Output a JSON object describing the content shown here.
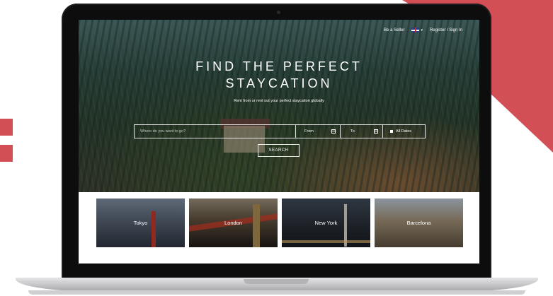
{
  "nav": {
    "be_seller": "Be a Seller",
    "register": "Register / Sign In",
    "language_icon": "uk-flag-icon"
  },
  "hero": {
    "headline_line1": "FIND THE PERFECT",
    "headline_line2": "STAYCATION",
    "tagline": "Rent from or rent out your perfect staycation globally"
  },
  "search": {
    "where_placeholder": "Where do you want to go?",
    "from_label": "From",
    "to_label": "To",
    "all_dates_label": "All Dates",
    "button_label": "SEARCH"
  },
  "cities": [
    {
      "name": "Tokyo"
    },
    {
      "name": "London"
    },
    {
      "name": "New York"
    },
    {
      "name": "Barcelona"
    }
  ],
  "colors": {
    "accent": "#d24f56",
    "bezel": "#0d0d0e"
  }
}
